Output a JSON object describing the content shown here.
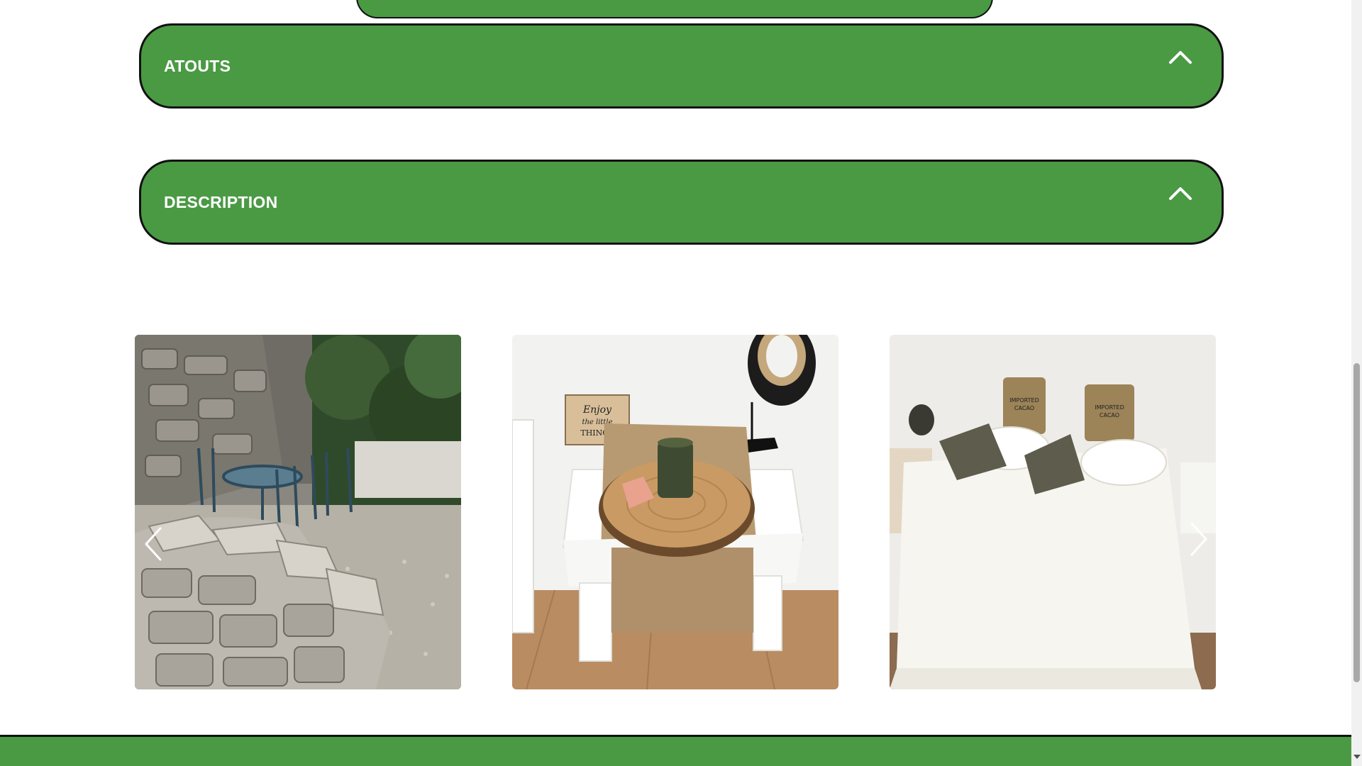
{
  "sections": [
    {
      "label": "ATOUTS",
      "icon": "chevron-up-icon",
      "state": "expanded"
    },
    {
      "label": "DESCRIPTION",
      "icon": "chevron-up-icon",
      "state": "expanded"
    }
  ],
  "gallery": {
    "photos": [
      {
        "subject": "stone-courtyard-with-blue-iron-table"
      },
      {
        "subject": "bedside-table-with-wood-slice-and-candle",
        "sign_text": "Enjoy the little THINGS"
      },
      {
        "subject": "bed-with-cushions",
        "cushion_text": "IMPORTED CACAO"
      }
    ],
    "prev_icon": "chevron-left-icon",
    "next_icon": "chevron-right-icon"
  },
  "colors": {
    "accent_green": "#4a9a44",
    "border": "#111111",
    "text_on_accent": "#ffffff"
  }
}
